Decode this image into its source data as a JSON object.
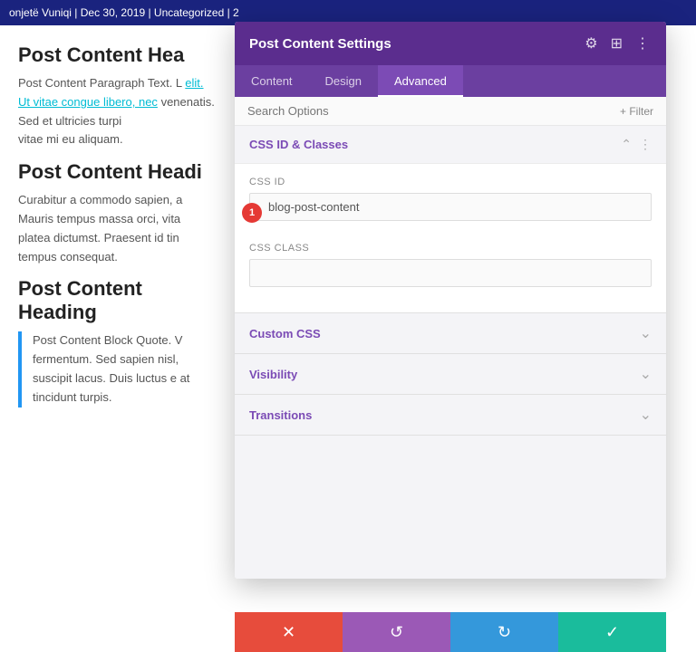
{
  "topbar": {
    "text": "onjetë Vuniqi | Dec 30, 2019 | Uncategorized | 2"
  },
  "blog": {
    "heading1": "Post Content Hea",
    "para1": "Post Content Paragraph Text. L",
    "para1cont": "elit. Ut vitae congue libero, nec",
    "para1cont2": "venenatis. Sed et ultricies turpi",
    "para1end": "vitae mi eu aliquam.",
    "heading2": "Post Content Headi",
    "para2": "Curabitur a commodo sapien, a",
    "para2cont": "Mauris tempus massa orci, vita",
    "para2cont2": "platea dictumst. Praesent id tin",
    "para2end": "tempus consequat.",
    "heading3": "Post Content Heading",
    "blockquote": "Post Content Block Quote. V fermentum. Sed sapien nisl, suscipit lacus. Duis luctus e at tincidunt turpis."
  },
  "panel": {
    "title": "Post Content Settings",
    "icons": {
      "settings": "⚙",
      "columns": "⊞",
      "more": "⋮"
    }
  },
  "tabs": [
    {
      "id": "content",
      "label": "Content",
      "active": false
    },
    {
      "id": "design",
      "label": "Design",
      "active": false
    },
    {
      "id": "advanced",
      "label": "Advanced",
      "active": true
    }
  ],
  "search": {
    "placeholder": "Search Options",
    "filter_label": "+ Filter"
  },
  "sections": [
    {
      "id": "css-id-classes",
      "title": "CSS ID & Classes",
      "expanded": true,
      "fields": [
        {
          "id": "css-id",
          "label": "CSS ID",
          "value": "blog-post-content",
          "badge": "1"
        },
        {
          "id": "css-class",
          "label": "CSS Class",
          "value": ""
        }
      ]
    },
    {
      "id": "custom-css",
      "title": "Custom CSS",
      "expanded": false
    },
    {
      "id": "visibility",
      "title": "Visibility",
      "expanded": false
    },
    {
      "id": "transitions",
      "title": "Transitions",
      "expanded": false
    }
  ],
  "actions": {
    "cancel": "✕",
    "undo": "↺",
    "redo": "↻",
    "save": "✓"
  }
}
